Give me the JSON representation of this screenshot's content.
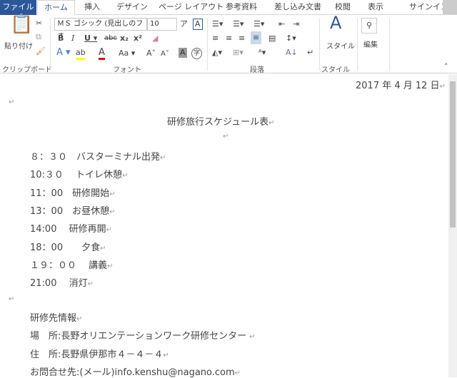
{
  "tabs": [
    "ファイル",
    "ホーム",
    "挿入",
    "デザイン",
    "ページ レイアウト",
    "参考資料",
    "差し込み文書",
    "校閲",
    "表示"
  ],
  "signin": "サインイン",
  "ribbon": {
    "paste": "貼り付け",
    "clipboard": "クリップボード",
    "font_group": "フォント",
    "paragraph": "段落",
    "styles_group": "スタイル",
    "styles": "スタイル",
    "edit": "編集",
    "font_name": "ＭＳ ゴシック (見出しのフォ",
    "font_size": "10"
  },
  "document": {
    "date": "2017 年 4 月 12 日",
    "title": "研修旅行スケジュール表",
    "schedule": [
      "８：３０　バスターミナル出発",
      "10:３０　 トイレ休憩",
      "11：00　研修開始",
      "13：00　お昼休憩",
      "14:00　 研修再開",
      "18：00　　夕食",
      "１９：００　 講義",
      "21:00　 消灯"
    ],
    "info": [
      "研修先情報",
      "場　所:長野オリエンテーションワーク研修センター ",
      "住　所:長野県伊那市４－４－４",
      "お問合せ先:(メール)info.kenshu@nagano.com"
    ]
  }
}
